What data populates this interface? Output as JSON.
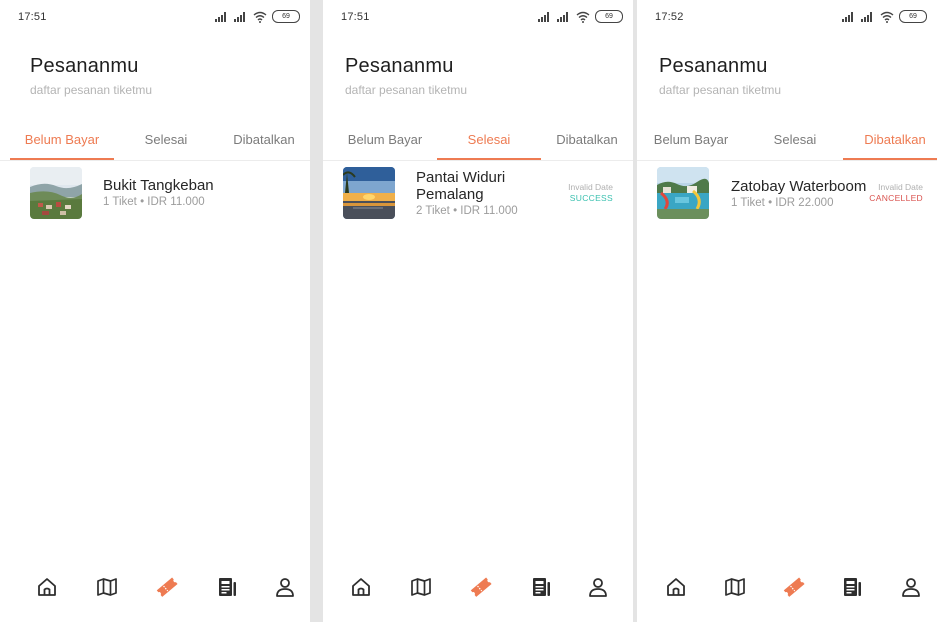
{
  "colors": {
    "accent": "#ee7b52",
    "success": "#3cc1b0",
    "cancelled": "#d9534f",
    "muted": "#9c9c9c"
  },
  "screens": [
    {
      "status_time": "17:51",
      "battery": "69",
      "title": "Pesananmu",
      "subtitle": "daftar pesanan tiketmu",
      "tabs": [
        "Belum Bayar",
        "Selesai",
        "Dibatalkan"
      ],
      "active_tab": "Belum Bayar",
      "orders": [
        {
          "name": "Bukit Tangkeban",
          "meta": "1 Tiket • IDR 11.000",
          "thumbnail": "hillside-town-photo"
        }
      ],
      "nav": [
        "home-icon",
        "map-icon",
        "ticket-icon",
        "news-icon",
        "profile-icon"
      ],
      "active_nav": "ticket-icon"
    },
    {
      "status_time": "17:51",
      "battery": "69",
      "title": "Pesananmu",
      "subtitle": "daftar pesanan tiketmu",
      "tabs": [
        "Belum Bayar",
        "Selesai",
        "Dibatalkan"
      ],
      "active_tab": "Selesai",
      "orders": [
        {
          "name": "Pantai Widuri Pemalang",
          "meta": "2 Tiket • IDR 11.000",
          "date": "Invalid Date",
          "status": "SUCCESS",
          "thumbnail": "beach-sunset-photo"
        }
      ],
      "nav": [
        "home-icon",
        "map-icon",
        "ticket-icon",
        "news-icon",
        "profile-icon"
      ],
      "active_nav": "ticket-icon"
    },
    {
      "status_time": "17:52",
      "battery": "69",
      "title": "Pesananmu",
      "subtitle": "daftar pesanan tiketmu",
      "tabs": [
        "Belum Bayar",
        "Selesai",
        "Dibatalkan"
      ],
      "active_tab": "Dibatalkan",
      "orders": [
        {
          "name": "Zatobay Waterboom",
          "meta": "1 Tiket • IDR 22.000",
          "date": "Invalid Date",
          "status": "CANCELLED",
          "thumbnail": "waterpark-photo"
        }
      ],
      "nav": [
        "home-icon",
        "map-icon",
        "ticket-icon",
        "news-icon",
        "profile-icon"
      ],
      "active_nav": "ticket-icon"
    }
  ]
}
